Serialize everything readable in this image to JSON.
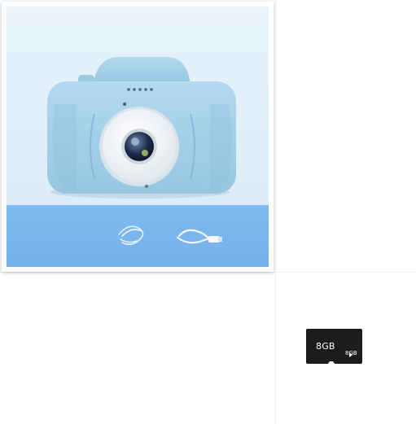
{
  "product_photo": {
    "colors": {
      "background": "#e4f0f9",
      "floor": "#7cb6ee",
      "camera_body": "#a6d2ea",
      "lens_ring": "#f2f4f6"
    },
    "items": [
      "camera-body",
      "lanyard-strap",
      "usb-cable"
    ]
  },
  "sd_card": {
    "capacity_label": "8GB",
    "capacity_small": "8GB",
    "color": "#1c1c1c"
  }
}
